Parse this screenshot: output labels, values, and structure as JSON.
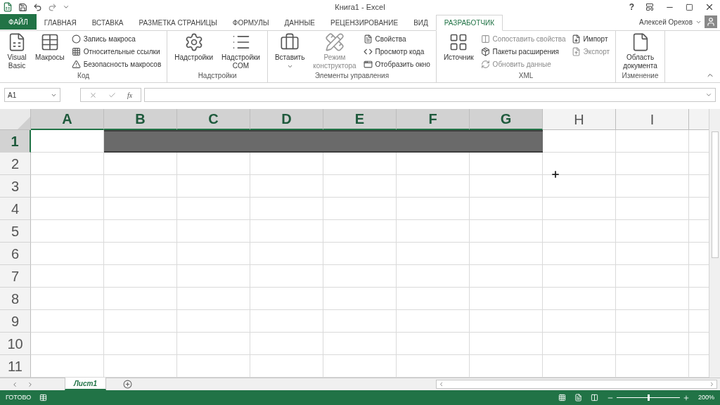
{
  "window": {
    "title": "Книга1 - Excel"
  },
  "title_bar": {
    "help": "?"
  },
  "tabs": [
    {
      "label": "ФАЙЛ",
      "kind": "file",
      "selected": false
    },
    {
      "label": "ГЛАВНАЯ",
      "kind": "tab",
      "selected": false
    },
    {
      "label": "ВСТАВКА",
      "kind": "tab",
      "selected": false
    },
    {
      "label": "РАЗМЕТКА СТРАНИЦЫ",
      "kind": "tab",
      "selected": false
    },
    {
      "label": "ФОРМУЛЫ",
      "kind": "tab",
      "selected": false
    },
    {
      "label": "ДАННЫЕ",
      "kind": "tab",
      "selected": false
    },
    {
      "label": "РЕЦЕНЗИРОВАНИЕ",
      "kind": "tab",
      "selected": false
    },
    {
      "label": "ВИД",
      "kind": "tab",
      "selected": false
    },
    {
      "label": "РАЗРАБОТЧИК",
      "kind": "tab",
      "selected": true
    }
  ],
  "user": {
    "name": "Алексей Орехов"
  },
  "ribbon_groups": [
    {
      "label": "Код",
      "items": [
        {
          "kind": "large",
          "label": "Visual Basic",
          "disabled": false
        },
        {
          "kind": "large",
          "label": "Макросы",
          "disabled": false
        },
        {
          "kind": "small",
          "label": "Запись макроса",
          "disabled": false
        },
        {
          "kind": "small",
          "label": "Относительные ссылки",
          "disabled": false
        },
        {
          "kind": "small",
          "label": "Безопасность макросов",
          "disabled": false
        }
      ]
    },
    {
      "label": "Надстройки",
      "items": [
        {
          "kind": "large",
          "label": "Надстройки",
          "disabled": false
        },
        {
          "kind": "large",
          "label": "Надстройки COM",
          "disabled": false
        }
      ]
    },
    {
      "label": "Элементы управления",
      "items": [
        {
          "kind": "dropdown",
          "label": "Вставить",
          "disabled": false
        },
        {
          "kind": "large",
          "label": "Режим конструктора",
          "disabled": true
        },
        {
          "kind": "small",
          "label": "Свойства",
          "disabled": false
        },
        {
          "kind": "small",
          "label": "Просмотр кода",
          "disabled": false
        },
        {
          "kind": "small",
          "label": "Отобразить окно",
          "disabled": false
        }
      ]
    },
    {
      "label": "XML",
      "items": [
        {
          "kind": "large",
          "label": "Источник",
          "disabled": false
        },
        {
          "kind": "small",
          "label": "Сопоставить свойства",
          "disabled": true
        },
        {
          "kind": "small",
          "label": "Пакеты расширения",
          "disabled": false
        },
        {
          "kind": "small",
          "label": "Обновить данные",
          "disabled": true
        },
        {
          "kind": "small",
          "label": "Импорт",
          "disabled": false
        },
        {
          "kind": "small",
          "label": "Экспорт",
          "disabled": true
        }
      ]
    },
    {
      "label": "Изменение",
      "items": [
        {
          "kind": "large",
          "label": "Область документа",
          "disabled": false
        }
      ]
    }
  ],
  "formula_bar": {
    "name_box": "A1",
    "function_button": "fx"
  },
  "columns": [
    {
      "label": "A",
      "selected": true
    },
    {
      "label": "B",
      "selected": true
    },
    {
      "label": "C",
      "selected": true
    },
    {
      "label": "D",
      "selected": true
    },
    {
      "label": "E",
      "selected": true
    },
    {
      "label": "F",
      "selected": true
    },
    {
      "label": "G",
      "selected": true
    },
    {
      "label": "H",
      "selected": false
    },
    {
      "label": "I",
      "selected": false
    }
  ],
  "rows": [
    {
      "label": "1",
      "selected": true,
      "cells": [
        {
          "filled": false
        },
        {
          "filled": true
        },
        {
          "filled": true
        },
        {
          "filled": true
        },
        {
          "filled": true
        },
        {
          "filled": true
        },
        {
          "filled": true
        },
        {
          "filled": false
        },
        {
          "filled": false
        },
        {
          "filled": false
        }
      ]
    },
    {
      "label": "2",
      "selected": false
    },
    {
      "label": "3",
      "selected": false
    },
    {
      "label": "4",
      "selected": false
    },
    {
      "label": "5",
      "selected": false
    },
    {
      "label": "6",
      "selected": false
    },
    {
      "label": "7",
      "selected": false
    },
    {
      "label": "8",
      "selected": false
    },
    {
      "label": "9",
      "selected": false
    },
    {
      "label": "10",
      "selected": false
    },
    {
      "label": "11",
      "selected": false
    }
  ],
  "sheets": [
    {
      "label": "Лист1",
      "selected": true
    }
  ],
  "status_bar": {
    "status": "ГОТОВО",
    "zoom": "200%",
    "zoom_slider": {
      "level": 0.5
    }
  }
}
